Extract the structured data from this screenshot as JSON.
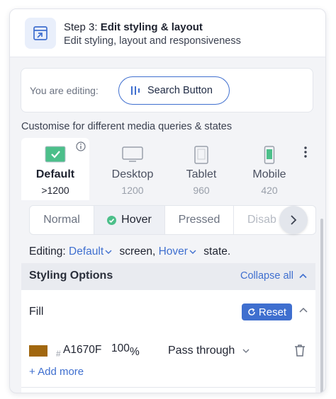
{
  "header": {
    "step": "Step 3:",
    "title": "Edit styling & layout",
    "subtitle": "Edit styling, layout and responsiveness",
    "icon": "open-in-window-icon"
  },
  "editing": {
    "label": "You are editing:",
    "target": "Search Button",
    "target_icon": "bars-icon"
  },
  "customise_text": "Customise for different media queries & states",
  "media_tabs": [
    {
      "name": "Default",
      "size": ">1200",
      "active": true
    },
    {
      "name": "Desktop",
      "size": "1200"
    },
    {
      "name": "Tablet",
      "size": "960"
    },
    {
      "name": "Mobile",
      "size": "420"
    }
  ],
  "state_tabs": [
    {
      "label": "Normal"
    },
    {
      "label": "Hover",
      "active": true
    },
    {
      "label": "Pressed"
    },
    {
      "label": "Disab"
    }
  ],
  "editing_line": {
    "prefix": "Editing:",
    "media": "Default",
    "media_suffix": "screen,",
    "state": "Hover",
    "state_suffix": "state."
  },
  "styling": {
    "title": "Styling Options",
    "collapse": "Collapse all"
  },
  "fill": {
    "title": "Fill",
    "reset": "Reset",
    "hash": "#",
    "hex": "A1670F",
    "opacity": "100",
    "percent": "%",
    "blend": "Pass through",
    "add_more": "+ Add more",
    "swatch_color": "#A1670F"
  },
  "colors": {
    "accent": "#3f6fcf",
    "check_green": "#4cbf8a"
  }
}
